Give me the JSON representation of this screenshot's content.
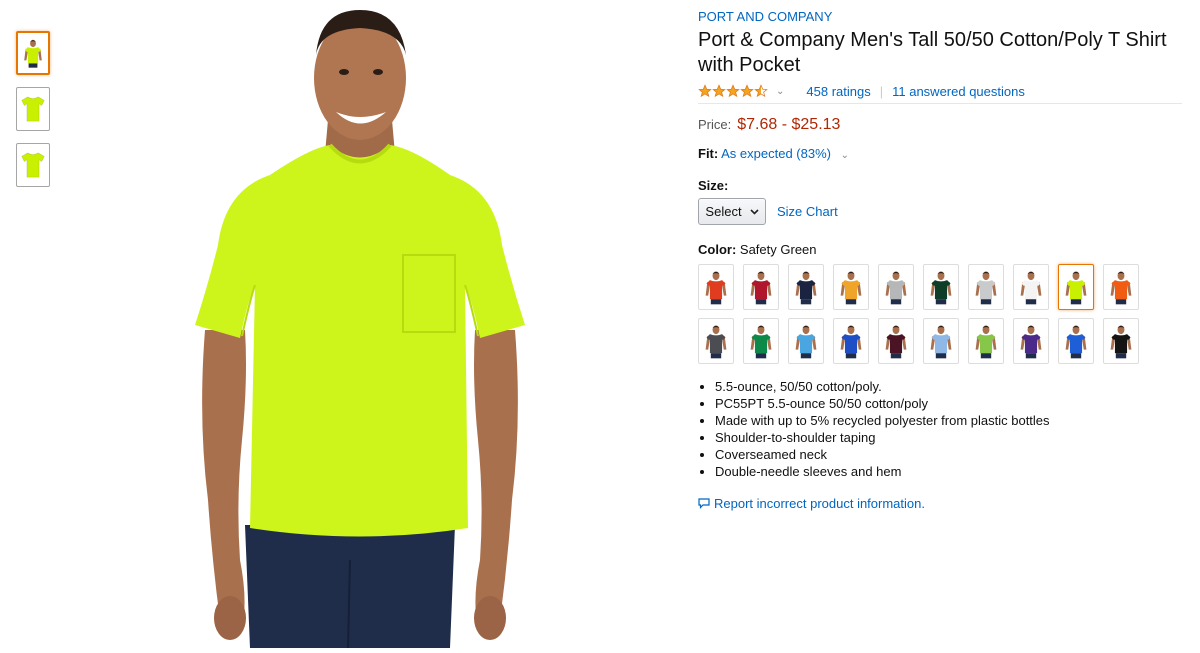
{
  "product": {
    "brand": "PORT AND COMPANY",
    "title": "Port & Company Men's Tall 50/50 Cotton/Poly T Shirt with Pocket",
    "rating": 4.5,
    "ratings_text": "458 ratings",
    "separator": "|",
    "questions_text": "11 answered questions",
    "price_label": "Price:",
    "price_range": "$7.68 - $25.13",
    "fit_label": "Fit:",
    "fit_value": "As expected (83%)",
    "size_label": "Size:",
    "size_select_value": "Select",
    "size_chart_label": "Size Chart",
    "color_label": "Color:",
    "color_value": "Safety Green",
    "report_text": "Report incorrect product information."
  },
  "thumbnails": [
    {
      "kind": "model",
      "color": "#c8f000",
      "active": true
    },
    {
      "kind": "shirt",
      "color": "#c8f000",
      "active": false
    },
    {
      "kind": "shirt",
      "color": "#c8f000",
      "active": false
    }
  ],
  "main_image": {
    "kind": "model",
    "shirt_color": "#cdf51b",
    "jeans_color": "#1f2d4a"
  },
  "swatches": [
    {
      "color": "#e03c1f",
      "selected": false
    },
    {
      "color": "#b0162c",
      "selected": false
    },
    {
      "color": "#1a2340",
      "selected": false
    },
    {
      "color": "#f0a52a",
      "selected": false
    },
    {
      "color": "#b5b7b9",
      "selected": false
    },
    {
      "color": "#0e3d2a",
      "selected": false
    },
    {
      "color": "#c9cacc",
      "selected": false
    },
    {
      "color": "#f4f4f4",
      "selected": false
    },
    {
      "color": "#c8f000",
      "selected": true
    },
    {
      "color": "#f25c12",
      "selected": false
    },
    {
      "color": "#4b4d52",
      "selected": false
    },
    {
      "color": "#0d8a4a",
      "selected": false
    },
    {
      "color": "#4aa6e0",
      "selected": false
    },
    {
      "color": "#1f4fc7",
      "selected": false
    },
    {
      "color": "#4a1424",
      "selected": false
    },
    {
      "color": "#8fb8e6",
      "selected": false
    },
    {
      "color": "#86c74a",
      "selected": false
    },
    {
      "color": "#4b2a8a",
      "selected": false
    },
    {
      "color": "#1e5ed6",
      "selected": false
    },
    {
      "color": "#141414",
      "selected": false
    }
  ],
  "bullets": [
    "5.5-ounce, 50/50 cotton/poly.",
    "PC55PT 5.5-ounce 50/50 cotton/poly",
    "Made with up to 5% recycled polyester from plastic bottles",
    "Shoulder-to-shoulder taping",
    "Coverseamed neck",
    "Double-needle sleeves and hem"
  ],
  "colors": {
    "link": "#0066c0",
    "price": "#b12704",
    "star": "#f4a41d",
    "selected_border": "#e77600"
  }
}
